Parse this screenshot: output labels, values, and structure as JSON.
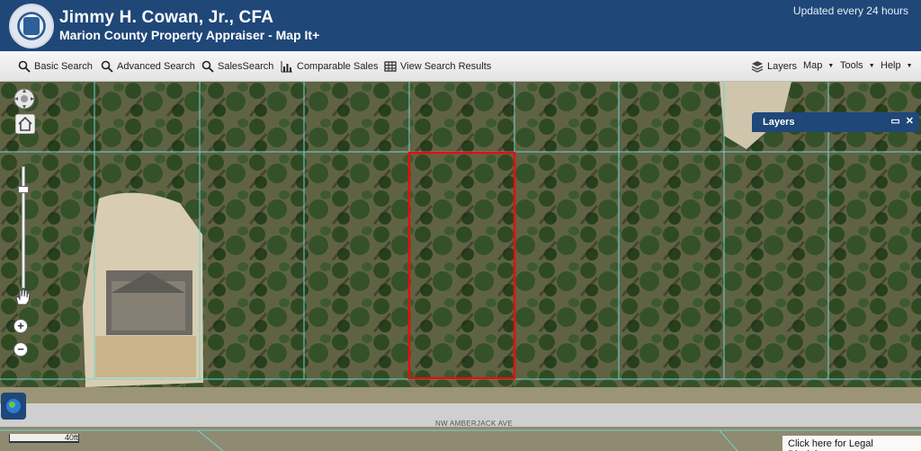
{
  "header": {
    "title": "Jimmy H. Cowan, Jr., CFA",
    "subtitle": "Marion County Property Appraiser - Map It+",
    "updated": "Updated every 24 hours"
  },
  "toolbar": {
    "basic_search": "Basic Search",
    "advanced_search": "Advanced Search",
    "sales_search": "SalesSearch",
    "comparable_sales": "Comparable Sales",
    "view_results": "View Search Results",
    "layers": "Layers",
    "map": "Map",
    "tools": "Tools",
    "help": "Help"
  },
  "map": {
    "layers_panel_title": "Layers",
    "street_label": "NW AMBERJACK AVE",
    "scale_label": "40ft",
    "disclaimer": "Click here for Legal Disclaimer"
  },
  "colors": {
    "header_bg": "#1f4778",
    "parcel_lines": "#6fd6d0",
    "selected_parcel": "#e01010"
  },
  "icons": [
    "property-appraiser-seal",
    "search-icon",
    "chart-icon",
    "table-icon",
    "layers-icon",
    "pan-icon",
    "home-icon",
    "hand-icon",
    "globe-icon",
    "maximize-icon",
    "close-icon"
  ]
}
